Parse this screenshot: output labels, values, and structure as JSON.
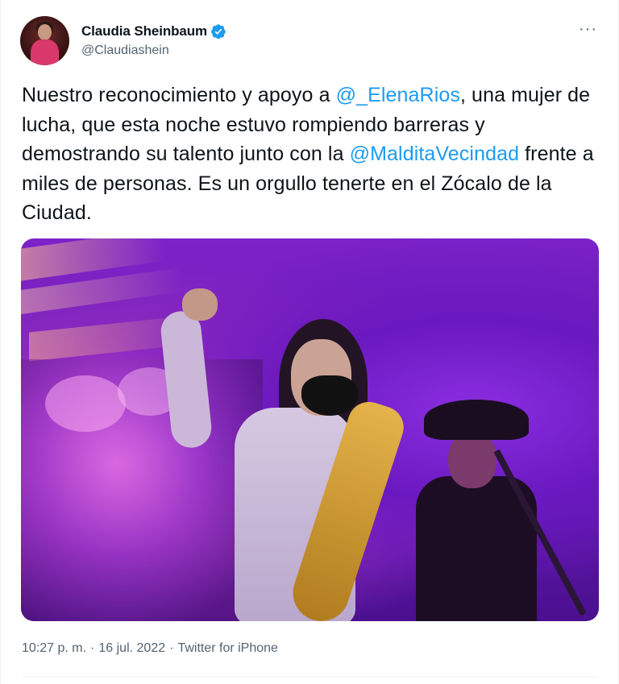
{
  "author": {
    "display_name": "Claudia Sheinbaum",
    "handle": "@Claudiashein",
    "verified_icon": "verified-badge-icon",
    "avatar_icon": "profile-avatar"
  },
  "more_menu": {
    "label": "···",
    "icon": "more-horizontal-icon"
  },
  "tweet": {
    "segments": [
      {
        "text": "Nuestro reconocimiento y apoyo a ",
        "type": "text"
      },
      {
        "text": "@_ElenaRios",
        "type": "mention"
      },
      {
        "text": ", una mujer de lucha, que esta noche estuvo rompiendo barreras y demostrando su talento junto con la ",
        "type": "text"
      },
      {
        "text": "@MalditaVecindad",
        "type": "mention"
      },
      {
        "text": " frente a miles de personas. Es un orgullo tenerte en el Zócalo de la Ciudad.",
        "type": "text"
      }
    ]
  },
  "media": {
    "kind": "photo",
    "subject": "concert-photo"
  },
  "meta": {
    "time": "10:27 p. m.",
    "separator": "·",
    "date": "16 jul. 2022",
    "source": "Twitter for iPhone"
  },
  "colors": {
    "text": "#0f1419",
    "secondary": "#536471",
    "link": "#1d9bf0",
    "verified": "#1d9bf0"
  }
}
